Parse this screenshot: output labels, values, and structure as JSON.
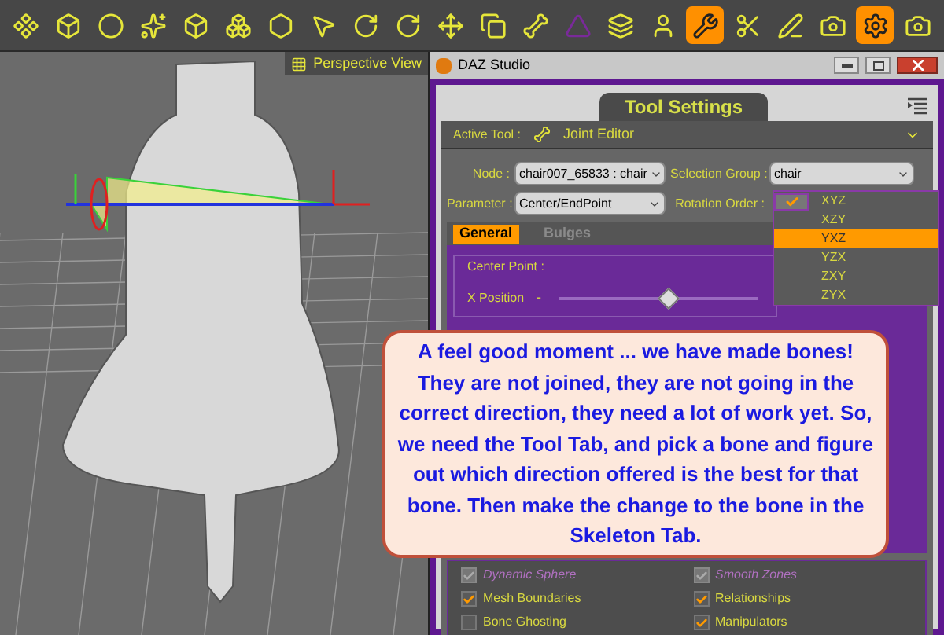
{
  "toolbar": {
    "buttons": [
      {
        "selected": false
      },
      {
        "selected": false
      },
      {
        "selected": false
      },
      {
        "selected": false
      },
      {
        "selected": false
      },
      {
        "selected": false
      },
      {
        "selected": false
      },
      {
        "selected": false
      },
      {
        "selected": false
      },
      {
        "selected": false
      },
      {
        "selected": false
      },
      {
        "selected": false
      },
      {
        "selected": false
      },
      {
        "selected": false
      },
      {
        "selected": false
      },
      {
        "selected": false
      },
      {
        "selected": true
      },
      {
        "selected": false
      },
      {
        "selected": false
      },
      {
        "selected": false
      },
      {
        "selected": true
      },
      {
        "selected": false
      }
    ]
  },
  "viewport": {
    "label": "Perspective View"
  },
  "window": {
    "title": "DAZ Studio"
  },
  "panel": {
    "tab": "Tool Settings",
    "active_tool_label": "Active Tool :",
    "active_tool": "Joint Editor",
    "node_label": "Node :",
    "node": "chair007_65833 : chair",
    "selection_group_label": "Selection Group :",
    "selection_group": "chair",
    "parameter_label": "Parameter :",
    "parameter": "Center/EndPoint",
    "rotation_order_label": "Rotation Order :",
    "rotation_orders": [
      {
        "label": "XYZ",
        "checked": true,
        "selected": false
      },
      {
        "label": "XZY",
        "checked": false,
        "selected": false
      },
      {
        "label": "YXZ",
        "checked": false,
        "selected": true
      },
      {
        "label": "YZX",
        "checked": false,
        "selected": false
      },
      {
        "label": "ZXY",
        "checked": false,
        "selected": false
      },
      {
        "label": "ZYX",
        "checked": false,
        "selected": false
      }
    ],
    "tabs": [
      {
        "label": "General",
        "selected": true
      },
      {
        "label": "Bulges",
        "selected": false
      }
    ],
    "group_title": "Center Point :",
    "slider": {
      "label": "X Position",
      "minus": "-",
      "level": 0.55
    },
    "options": [
      {
        "label": "Dynamic Sphere",
        "checked": true,
        "disabled": true
      },
      {
        "label": "Smooth Zones",
        "checked": true,
        "disabled": true
      },
      {
        "label": "Mesh Boundaries",
        "checked": true,
        "disabled": false
      },
      {
        "label": "Relationships",
        "checked": true,
        "disabled": false
      },
      {
        "label": "Bone Ghosting",
        "checked": false,
        "disabled": false
      },
      {
        "label": "Manipulators",
        "checked": true,
        "disabled": false
      }
    ]
  },
  "callout": {
    "text": "A feel good moment ... we have made bones! They are not joined, they are not going in the correct direction, they need a lot of work yet. So, we need the Tool Tab, and pick a bone and figure out which direction offered is the best for that bone. Then make the change to the bone in the Skeleton Tab."
  }
}
